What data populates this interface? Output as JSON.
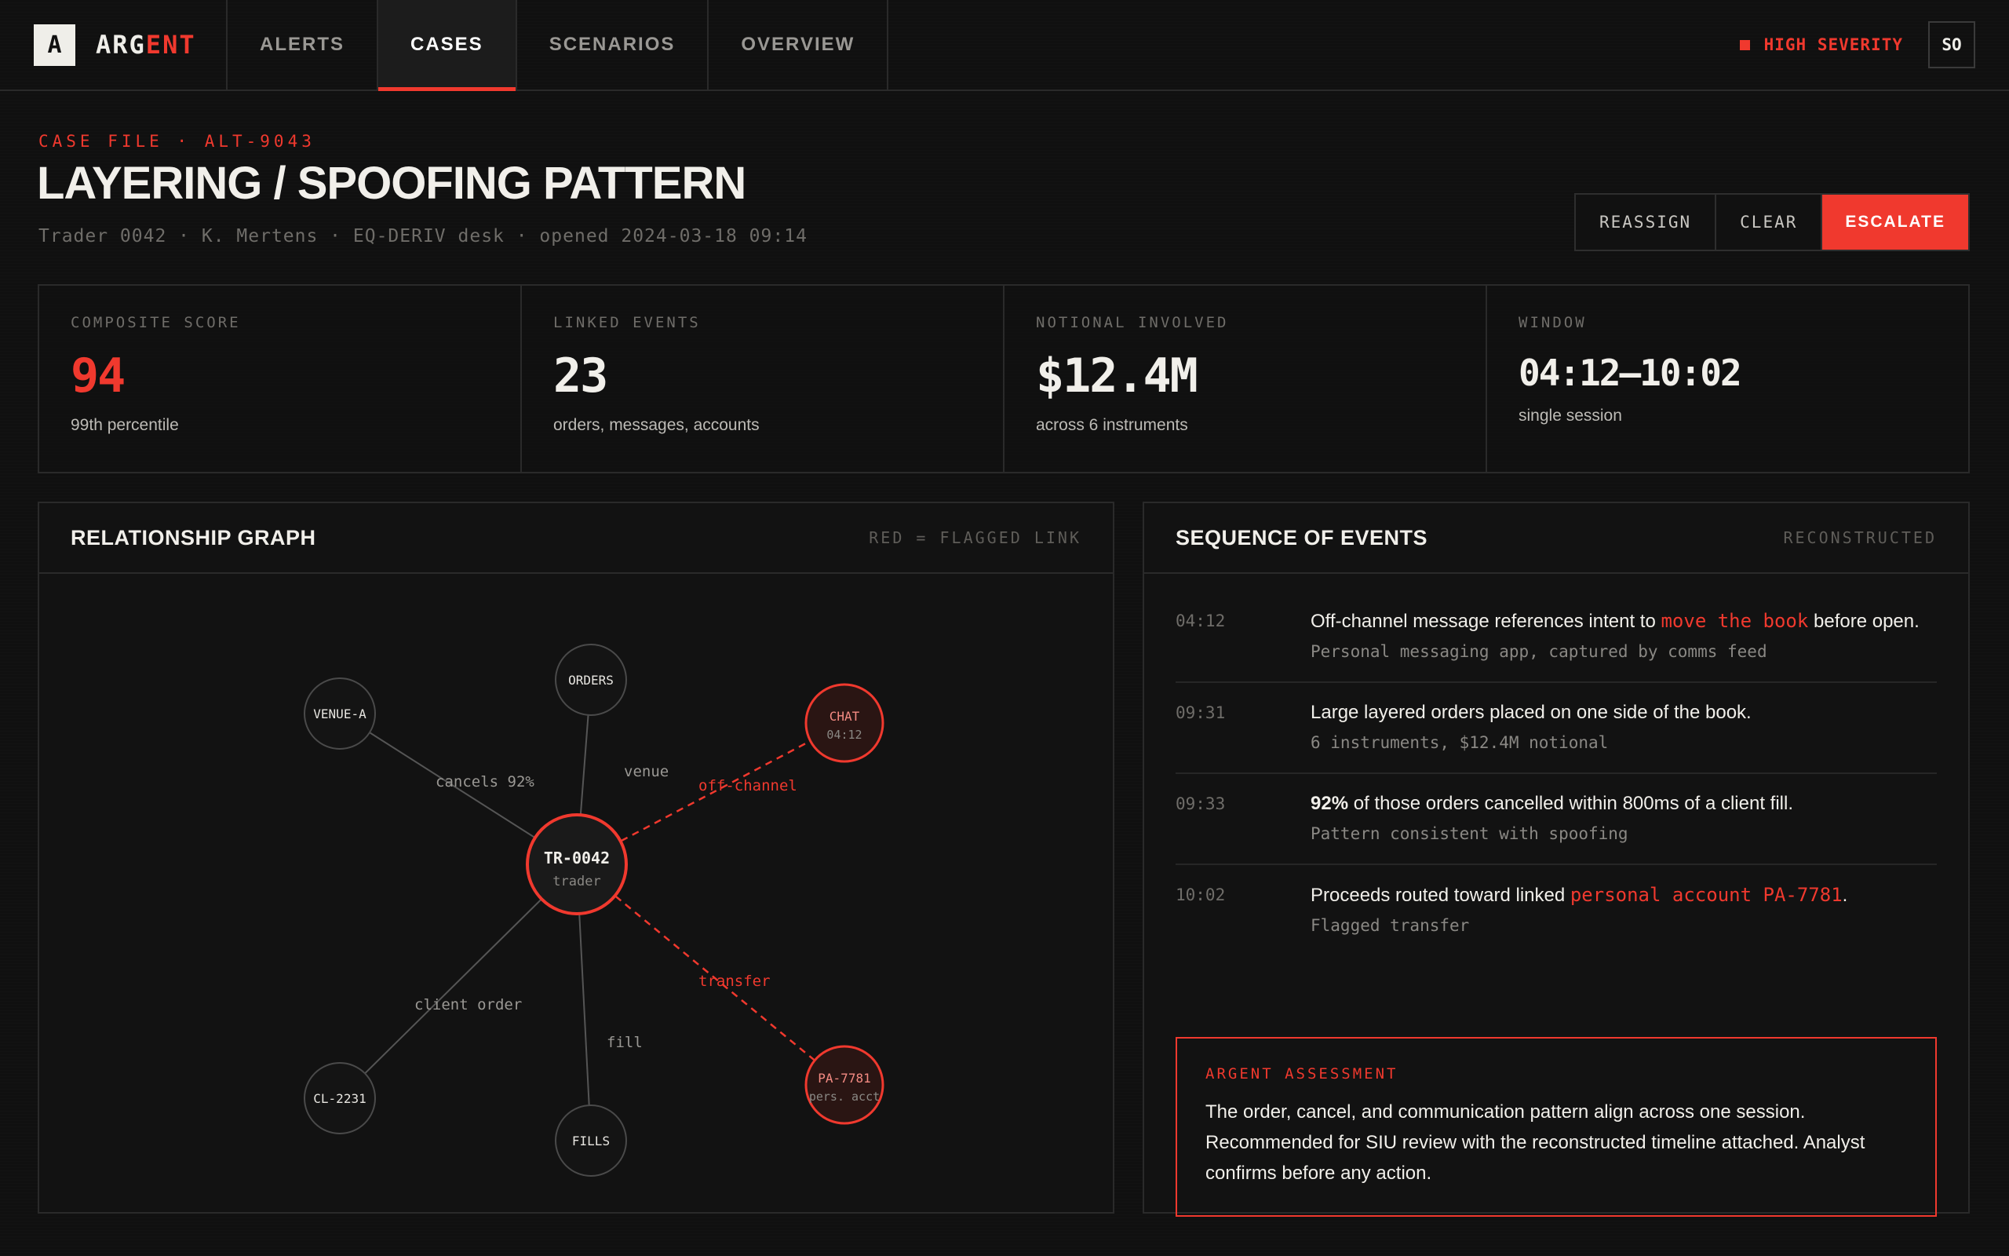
{
  "brand": {
    "logo_letter": "A",
    "name_prefix": "ARG",
    "name_accent": "ENT"
  },
  "nav": {
    "tabs": [
      "ALERTS",
      "CASES",
      "SCENARIOS",
      "OVERVIEW"
    ],
    "active": "CASES"
  },
  "status": {
    "severity": "HIGH SEVERITY",
    "user_initials": "SO"
  },
  "case": {
    "eyebrow": "CASE FILE · ALT-9043",
    "title": "LAYERING / SPOOFING PATTERN",
    "meta": "Trader 0042 · K. Mertens · EQ-DERIV desk · opened 2024-03-18 09:14"
  },
  "actions": {
    "reassign": "REASSIGN",
    "clear": "CLEAR",
    "escalate": "ESCALATE"
  },
  "metrics": [
    {
      "label": "COMPOSITE SCORE",
      "value": "94",
      "sub": "99th percentile"
    },
    {
      "label": "LINKED EVENTS",
      "value": "23",
      "sub": "orders, messages, accounts"
    },
    {
      "label": "NOTIONAL INVOLVED",
      "value": "$12.4M",
      "sub": "across 6 instruments"
    },
    {
      "label": "WINDOW",
      "value": "04:12–10:02",
      "sub": "single session"
    }
  ],
  "graph": {
    "title": "RELATIONSHIP GRAPH",
    "note": "RED = FLAGGED LINK",
    "center": {
      "label": "TR-0042",
      "sub": "trader"
    },
    "nodes": {
      "orders": "ORDERS",
      "venue_a": "VENUE-A",
      "chat": "CHAT",
      "chat_sub": "04:12",
      "cl": "CL-2231",
      "fills": "FILLS",
      "pa": "PA-7781",
      "pa_sub": "pers. acct"
    },
    "edges": {
      "venue": "venue",
      "cancels": "cancels 92%",
      "offchannel": "off-channel",
      "client_order": "client order",
      "fill": "fill",
      "transfer": "transfer"
    }
  },
  "sequence": {
    "title": "SEQUENCE OF EVENTS",
    "note": "RECONSTRUCTED",
    "events": [
      {
        "time": "04:12",
        "pre": "Off-channel message references intent to ",
        "hl": "move the book",
        "post": " before open.",
        "sub": "Personal messaging app, captured by comms feed"
      },
      {
        "time": "09:31",
        "pre": "Large layered orders placed on one side of the book.",
        "sub": "6 instruments, $12.4M notional"
      },
      {
        "time": "09:33",
        "bold": "92%",
        "pre": " of those orders cancelled within 800ms of a client fill.",
        "sub": "Pattern consistent with spoofing"
      },
      {
        "time": "10:02",
        "pre": "Proceeds routed toward linked ",
        "hl": "personal account PA-7781",
        "post": ".",
        "sub": "Flagged transfer"
      }
    ]
  },
  "assessment": {
    "label": "ARGENT ASSESSMENT",
    "text": "The order, cancel, and communication pattern align across one session. Recommended for SIU review with the reconstructed timeline attached. Analyst confirms before any action."
  },
  "colors": {
    "accent": "#f0392e",
    "background": "#101010",
    "panel": "#121212",
    "border": "#2a2a2a"
  }
}
